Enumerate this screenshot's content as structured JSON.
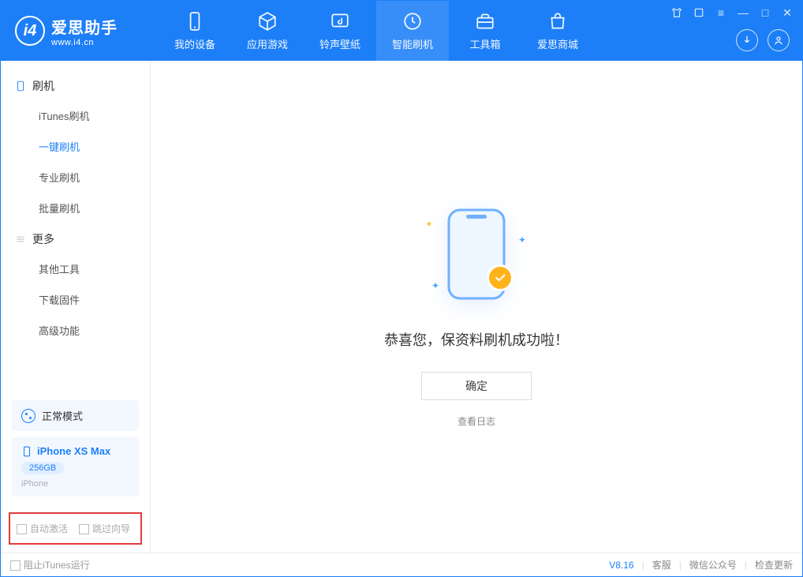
{
  "app": {
    "name": "爱思助手",
    "url": "www.i4.cn"
  },
  "nav": {
    "items": [
      {
        "label": "我的设备"
      },
      {
        "label": "应用游戏"
      },
      {
        "label": "铃声壁纸"
      },
      {
        "label": "智能刷机"
      },
      {
        "label": "工具箱"
      },
      {
        "label": "爱思商城"
      }
    ]
  },
  "sidebar": {
    "section1": "刷机",
    "items1": [
      {
        "label": "iTunes刷机"
      },
      {
        "label": "一键刷机"
      },
      {
        "label": "专业刷机"
      },
      {
        "label": "批量刷机"
      }
    ],
    "section2": "更多",
    "items2": [
      {
        "label": "其他工具"
      },
      {
        "label": "下载固件"
      },
      {
        "label": "高级功能"
      }
    ],
    "mode": "正常模式",
    "device": {
      "name": "iPhone XS Max",
      "capacity": "256GB",
      "type": "iPhone"
    },
    "chk_auto": "自动激活",
    "chk_skip": "跳过向导"
  },
  "main": {
    "success": "恭喜您，保资料刷机成功啦！",
    "ok": "确定",
    "view_log": "查看日志"
  },
  "footer": {
    "block_itunes": "阻止iTunes运行",
    "version": "V8.16",
    "support": "客服",
    "wechat": "微信公众号",
    "update": "检查更新"
  }
}
